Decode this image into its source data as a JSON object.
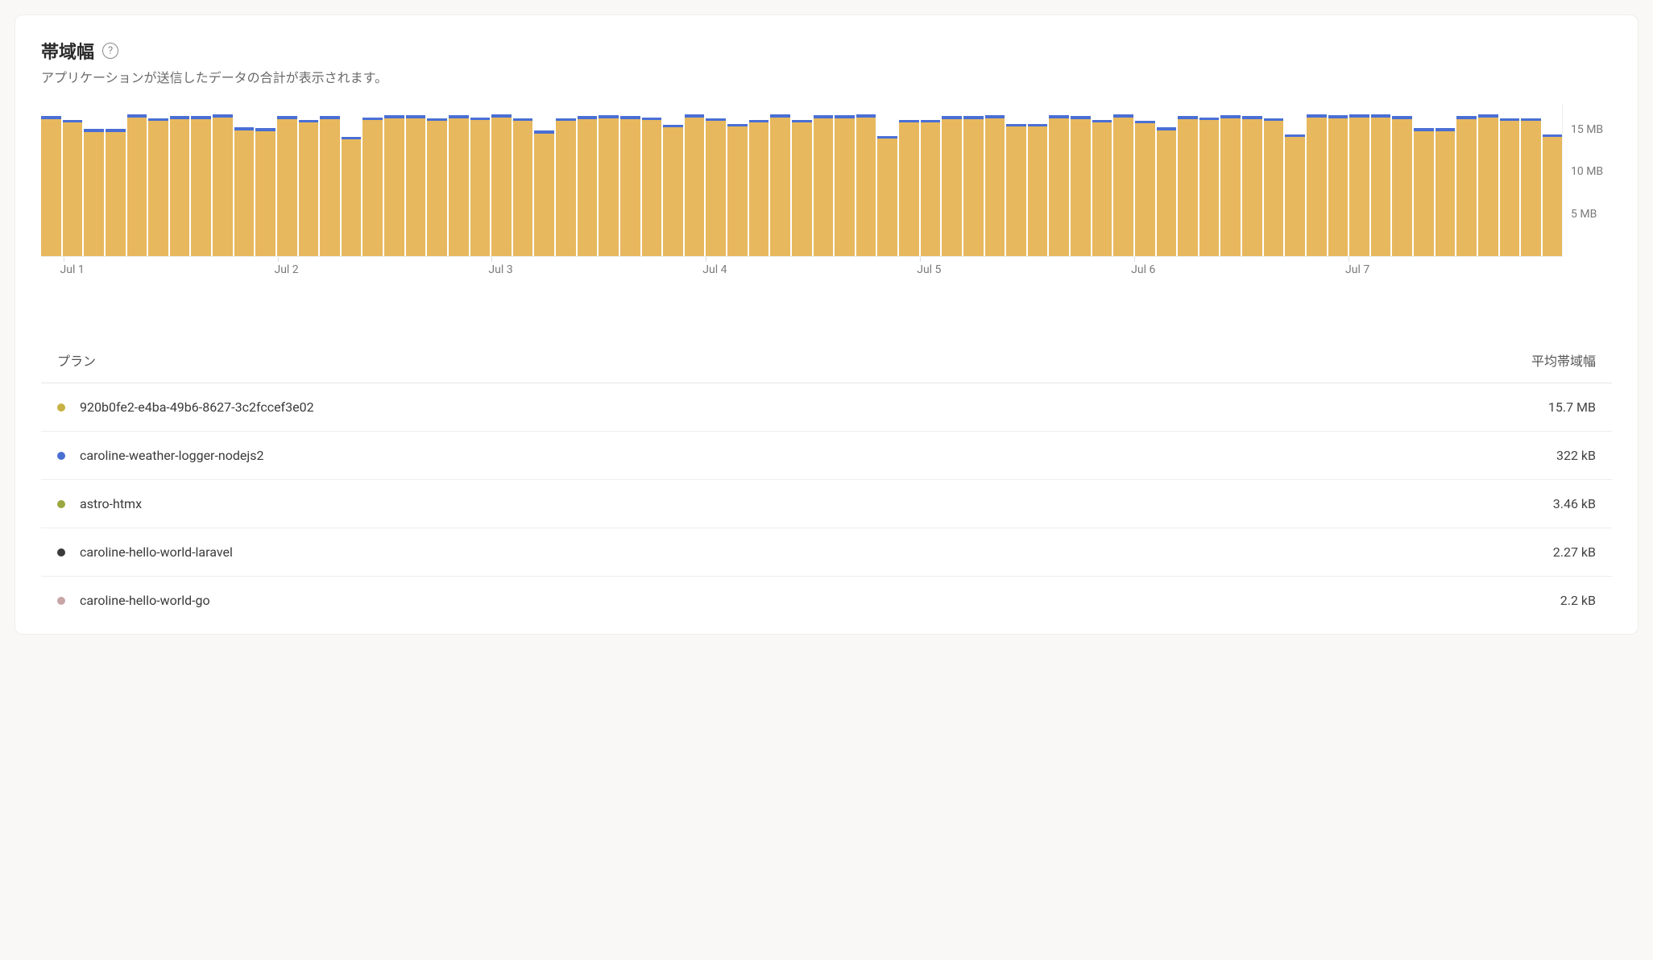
{
  "header": {
    "title": "帯域幅",
    "help_tooltip": "?",
    "subtitle": "アプリケーションが送信したデータの合計が表示されます。"
  },
  "chart_data": {
    "type": "bar",
    "stacked": true,
    "ylabel": "",
    "xlabel": "",
    "y_unit": "MB",
    "ylim": [
      0,
      18
    ],
    "y_ticks": [
      5,
      10,
      15
    ],
    "y_tick_labels": [
      "5 MB",
      "10 MB",
      "15 MB"
    ],
    "x_major_ticks": [
      "Jul 1",
      "Jul 2",
      "Jul 3",
      "Jul 4",
      "Jul 5",
      "Jul 6",
      "Jul 7"
    ],
    "x_major_index": [
      1,
      11,
      21,
      31,
      41,
      51,
      61
    ],
    "series": [
      {
        "name": "920b0fe2-e4ba-49b6-8627-3c2fccef3e02",
        "color": "#e7b85e"
      },
      {
        "name": "caroline-weather-logger-nodejs2",
        "color": "#4a6fd4"
      }
    ],
    "bars": [
      {
        "main": 16.2,
        "top": 0.33
      },
      {
        "main": 15.8,
        "top": 0.33
      },
      {
        "main": 14.7,
        "top": 0.33
      },
      {
        "main": 14.7,
        "top": 0.33
      },
      {
        "main": 16.4,
        "top": 0.33
      },
      {
        "main": 16.0,
        "top": 0.33
      },
      {
        "main": 16.2,
        "top": 0.33
      },
      {
        "main": 16.2,
        "top": 0.33
      },
      {
        "main": 16.4,
        "top": 0.33
      },
      {
        "main": 14.9,
        "top": 0.33
      },
      {
        "main": 14.8,
        "top": 0.33
      },
      {
        "main": 16.2,
        "top": 0.33
      },
      {
        "main": 15.8,
        "top": 0.33
      },
      {
        "main": 16.2,
        "top": 0.33
      },
      {
        "main": 13.8,
        "top": 0.33
      },
      {
        "main": 16.1,
        "top": 0.33
      },
      {
        "main": 16.3,
        "top": 0.33
      },
      {
        "main": 16.3,
        "top": 0.33
      },
      {
        "main": 16.0,
        "top": 0.33
      },
      {
        "main": 16.3,
        "top": 0.33
      },
      {
        "main": 16.1,
        "top": 0.33
      },
      {
        "main": 16.4,
        "top": 0.33
      },
      {
        "main": 16.0,
        "top": 0.33
      },
      {
        "main": 14.5,
        "top": 0.33
      },
      {
        "main": 16.0,
        "top": 0.33
      },
      {
        "main": 16.2,
        "top": 0.33
      },
      {
        "main": 16.3,
        "top": 0.33
      },
      {
        "main": 16.2,
        "top": 0.33
      },
      {
        "main": 16.1,
        "top": 0.33
      },
      {
        "main": 15.2,
        "top": 0.33
      },
      {
        "main": 16.4,
        "top": 0.33
      },
      {
        "main": 16.0,
        "top": 0.33
      },
      {
        "main": 15.3,
        "top": 0.33
      },
      {
        "main": 15.8,
        "top": 0.33
      },
      {
        "main": 16.4,
        "top": 0.33
      },
      {
        "main": 15.8,
        "top": 0.33
      },
      {
        "main": 16.3,
        "top": 0.33
      },
      {
        "main": 16.3,
        "top": 0.33
      },
      {
        "main": 16.4,
        "top": 0.33
      },
      {
        "main": 13.9,
        "top": 0.33
      },
      {
        "main": 15.8,
        "top": 0.33
      },
      {
        "main": 15.8,
        "top": 0.33
      },
      {
        "main": 16.2,
        "top": 0.33
      },
      {
        "main": 16.2,
        "top": 0.33
      },
      {
        "main": 16.3,
        "top": 0.33
      },
      {
        "main": 15.3,
        "top": 0.33
      },
      {
        "main": 15.3,
        "top": 0.33
      },
      {
        "main": 16.3,
        "top": 0.33
      },
      {
        "main": 16.2,
        "top": 0.33
      },
      {
        "main": 15.8,
        "top": 0.33
      },
      {
        "main": 16.4,
        "top": 0.33
      },
      {
        "main": 15.7,
        "top": 0.33
      },
      {
        "main": 14.9,
        "top": 0.33
      },
      {
        "main": 16.2,
        "top": 0.33
      },
      {
        "main": 16.1,
        "top": 0.33
      },
      {
        "main": 16.3,
        "top": 0.33
      },
      {
        "main": 16.2,
        "top": 0.33
      },
      {
        "main": 16.0,
        "top": 0.33
      },
      {
        "main": 14.1,
        "top": 0.33
      },
      {
        "main": 16.4,
        "top": 0.33
      },
      {
        "main": 16.3,
        "top": 0.33
      },
      {
        "main": 16.4,
        "top": 0.33
      },
      {
        "main": 16.4,
        "top": 0.33
      },
      {
        "main": 16.2,
        "top": 0.33
      },
      {
        "main": 14.8,
        "top": 0.33
      },
      {
        "main": 14.8,
        "top": 0.33
      },
      {
        "main": 16.2,
        "top": 0.33
      },
      {
        "main": 16.4,
        "top": 0.33
      },
      {
        "main": 16.0,
        "top": 0.33
      },
      {
        "main": 16.0,
        "top": 0.33
      },
      {
        "main": 14.1,
        "top": 0.33
      }
    ]
  },
  "table": {
    "header_plan": "プラン",
    "header_avg": "平均帯域幅",
    "rows": [
      {
        "color": "#c8b144",
        "name": "920b0fe2-e4ba-49b6-8627-3c2fccef3e02",
        "value": "15.7 MB"
      },
      {
        "color": "#4a6fd4",
        "name": "caroline-weather-logger-nodejs2",
        "value": "322 kB"
      },
      {
        "color": "#9aa83f",
        "name": "astro-htmx",
        "value": "3.46 kB"
      },
      {
        "color": "#3a3a3a",
        "name": "caroline-hello-world-laravel",
        "value": "2.27 kB"
      },
      {
        "color": "#c9a6a6",
        "name": "caroline-hello-world-go",
        "value": "2.2 kB"
      }
    ]
  }
}
